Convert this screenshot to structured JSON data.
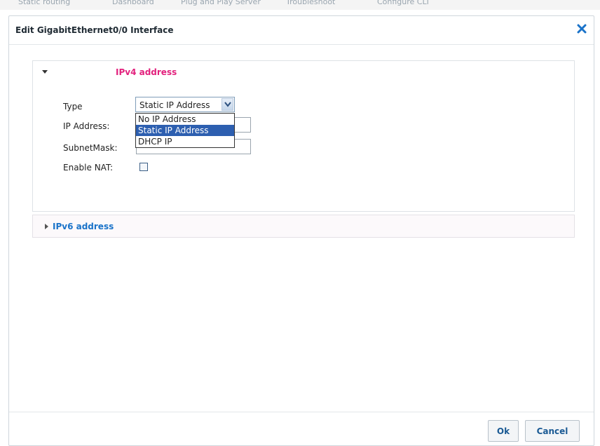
{
  "background_tabs": [
    "Static routing",
    "Dashboard",
    "Plug and Play Server",
    "Troubleshoot",
    "Configure CLI"
  ],
  "dialog": {
    "title": "Edit GigabitEthernet0/0 Interface",
    "close_icon": "close-x-icon",
    "accent_color": "#1a73c9"
  },
  "ipv4": {
    "title": "IPv4 address",
    "title_color": "#e2217d",
    "expanded": true,
    "type_label": "Type",
    "type_value": "Static IP Address",
    "type_options": [
      "No IP Address",
      "Static IP Address",
      "DHCP IP"
    ],
    "type_selected_index": 1,
    "ip_label": "IP Address:",
    "ip_value": "",
    "mask_label": "SubnetMask:",
    "mask_value": "",
    "nat_label": "Enable NAT:",
    "nat_checked": false
  },
  "ipv6": {
    "title": "IPv6 address",
    "expanded": false
  },
  "footer": {
    "ok_label": "Ok",
    "cancel_label": "Cancel"
  }
}
